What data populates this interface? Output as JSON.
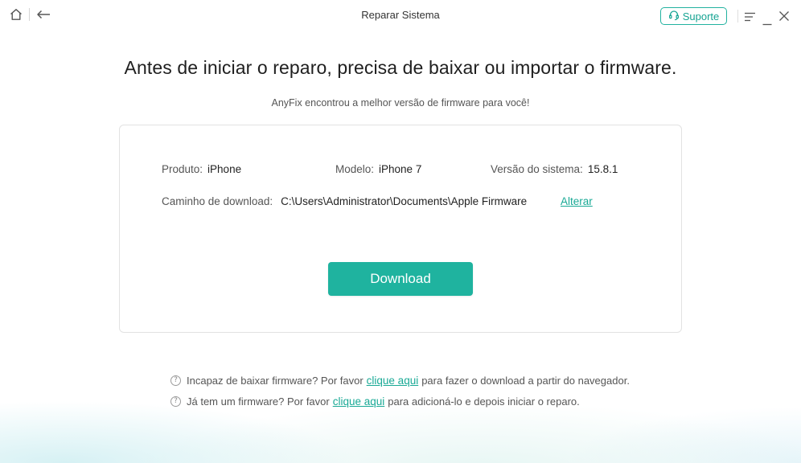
{
  "window": {
    "title": "Reparar Sistema",
    "support_label": "Suporte"
  },
  "icons": {
    "home": "home-icon",
    "back": "back-arrow-icon",
    "headset": "headset-icon",
    "menu": "menu-icon",
    "minimize": "minimize-icon",
    "close": "close-icon",
    "help": "question-circle-icon"
  },
  "main": {
    "headline": "Antes de iniciar o reparo, precisa de baixar ou importar o firmware.",
    "subline": "AnyFix encontrou a melhor versão de firmware para você!",
    "product_label": "Produto:",
    "product_value": "iPhone",
    "model_label": "Modelo:",
    "model_value": "iPhone 7",
    "version_label": "Versão do sistema:",
    "version_value": "15.8.1",
    "path_label": "Caminho de download:",
    "path_value": "C:\\Users\\Administrator\\Documents\\Apple Firmware",
    "change_link": "Alterar",
    "download_button": "Download"
  },
  "help": {
    "line1_prefix": "Incapaz de baixar firmware? Por favor",
    "line1_link": "clique aqui",
    "line1_suffix": "para fazer o download a partir do navegador.",
    "line2_prefix": "Já tem um firmware? Por favor",
    "line2_link": "clique aqui",
    "line2_suffix": "para adicioná-lo e depois iniciar o reparo.",
    "question_mark": "?"
  },
  "colors": {
    "accent": "#1fb39f",
    "link": "#19a995",
    "text": "#333333"
  }
}
